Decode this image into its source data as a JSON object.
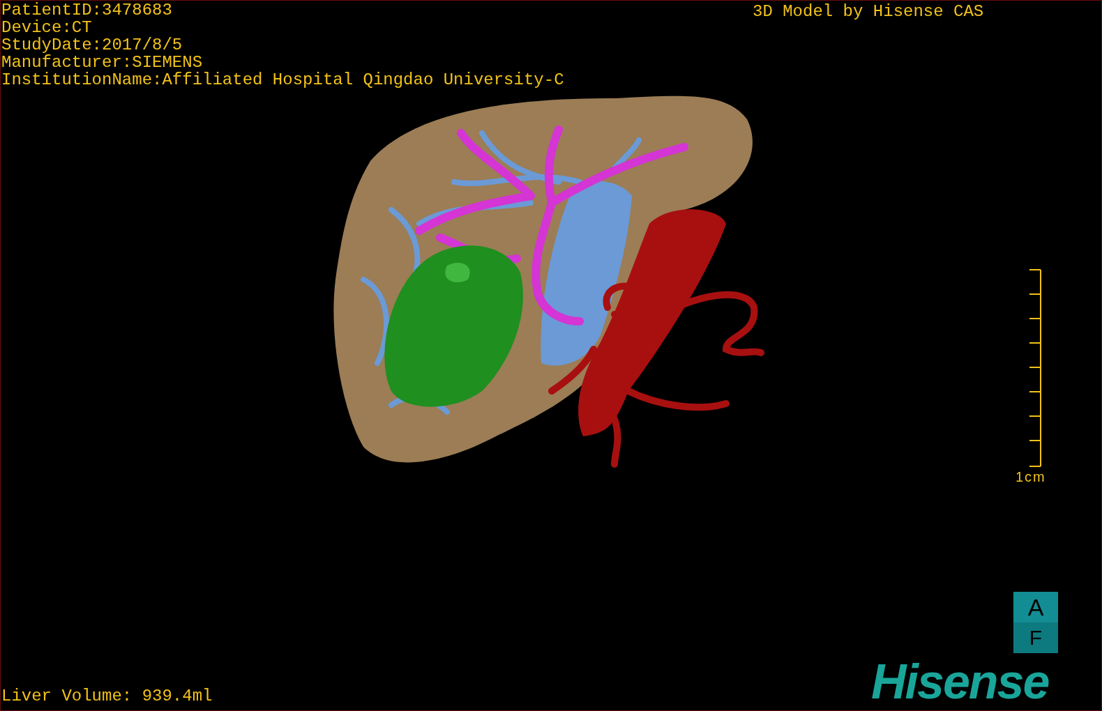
{
  "patient_info": [
    "PatientID:3478683",
    "Device:CT",
    "StudyDate:2017/8/5",
    "Manufacturer:SIEMENS",
    "InstitutionName:Affiliated Hospital Qingdao University-C"
  ],
  "model_credit": "3D Model by Hisense CAS",
  "scale_bar": {
    "label": "1cm"
  },
  "orientation_cube": [
    "A",
    "F"
  ],
  "liver_volume": "Liver Volume: 939.4ml",
  "logo": "Hisense"
}
